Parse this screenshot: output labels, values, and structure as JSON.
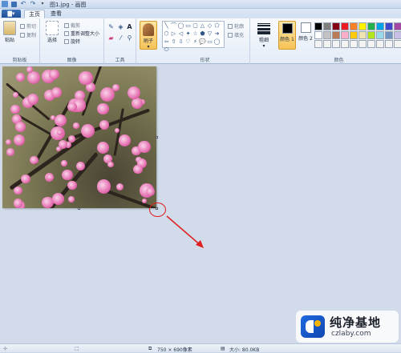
{
  "window": {
    "title": "图1.jpg - 画图"
  },
  "tabs": [
    {
      "label": "主页"
    },
    {
      "label": "查看"
    }
  ],
  "ribbon": {
    "clipboard": {
      "paste": "粘贴",
      "cut": "剪切",
      "copy": "复制",
      "label": "剪贴板"
    },
    "image": {
      "crop": "裁剪",
      "select": "选择",
      "resize": "重新调整大小",
      "rotate": "旋转",
      "label": "图像"
    },
    "tools": {
      "label": "工具",
      "text_tool": "A"
    },
    "brush": {
      "label": "刷子"
    },
    "shapes": {
      "outline": "轮廓",
      "fill": "填充",
      "label": "形状",
      "glyphs": [
        "╲",
        "⌒",
        "◯",
        "▭",
        "▢",
        "△",
        "◇",
        "⬠",
        "⬡",
        "▷",
        "◁",
        "✦",
        "☆",
        "⬟",
        "▽",
        "➔",
        "⇦",
        "⇧",
        "⇩",
        "♡",
        "⚡",
        "💬",
        "▭",
        "◯",
        "⬭"
      ]
    },
    "size": {
      "label": "粗细"
    },
    "colors": {
      "color1": "颜色 1",
      "color2": "颜色 2",
      "label": "颜色",
      "color1_value": "#000000",
      "color2_value": "#ffffff",
      "palette": [
        "#000000",
        "#7f7f7f",
        "#880015",
        "#ed1c24",
        "#ff7f27",
        "#fff200",
        "#22b14c",
        "#00a2e8",
        "#3f48cc",
        "#a349a4",
        "#ffffff",
        "#c3c3c3",
        "#b97a57",
        "#ffaec9",
        "#ffc90e",
        "#efe4b0",
        "#b5e61d",
        "#99d9ea",
        "#7092be",
        "#c8bfe7",
        "#f3f3f3",
        "#f3f3f3",
        "#f3f3f3",
        "#f3f3f3",
        "#f3f3f3",
        "#f3f3f3",
        "#f3f3f3",
        "#f3f3f3",
        "#f3f3f3",
        "#f3f3f3"
      ]
    }
  },
  "status": {
    "dimensions": "750 × 690像素",
    "filesize": "大小: 80.0KB"
  },
  "watermark": {
    "title": "纯净基地",
    "url": "czlaby.com"
  },
  "annotation": {
    "arrow_color": "#e02020"
  }
}
